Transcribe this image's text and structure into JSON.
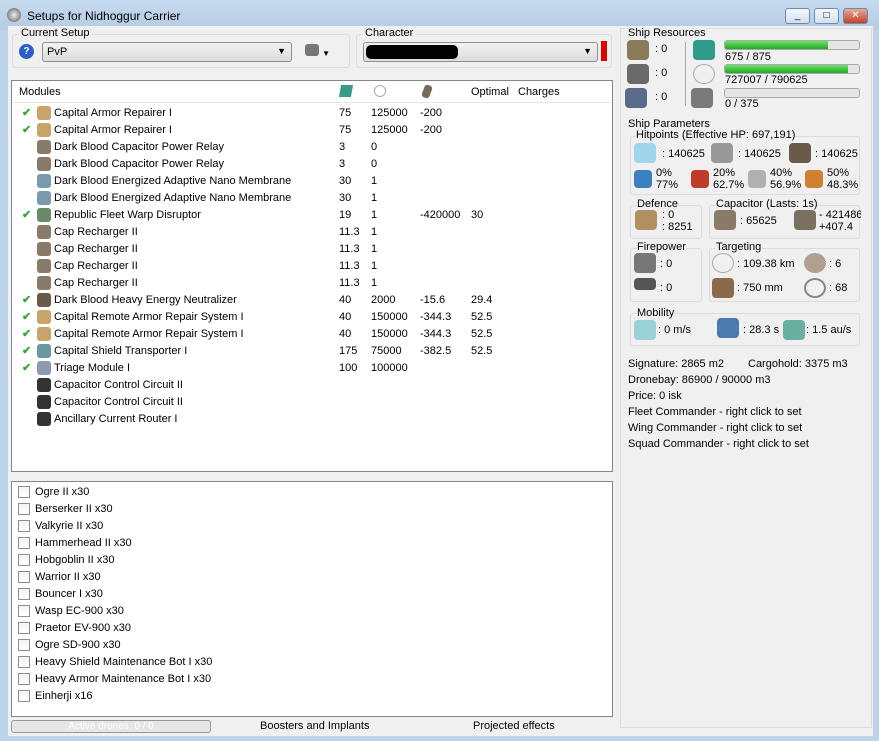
{
  "window": {
    "title": "Setups for Nidhoggur Carrier",
    "buttons": [
      "_",
      "□",
      "✕"
    ]
  },
  "setup": {
    "label": "Current Setup",
    "value": "PvP"
  },
  "character": {
    "label": "Character",
    "value": ""
  },
  "modules": {
    "headers": [
      "Modules",
      "",
      "",
      "",
      "Optimal",
      "Charges"
    ],
    "rows": [
      {
        "on": true,
        "name": "Capital Armor Repairer I",
        "cpu": "75",
        "pg": "125000",
        "cap": "-200",
        "opt": "",
        "icon": "#c9a46a"
      },
      {
        "on": true,
        "name": "Capital Armor Repairer I",
        "cpu": "75",
        "pg": "125000",
        "cap": "-200",
        "opt": "",
        "icon": "#c9a46a"
      },
      {
        "on": false,
        "name": "Dark Blood Capacitor Power Relay",
        "cpu": "3",
        "pg": "0",
        "cap": "",
        "opt": "",
        "icon": "#8a7a6a"
      },
      {
        "on": false,
        "name": "Dark Blood Capacitor Power Relay",
        "cpu": "3",
        "pg": "0",
        "cap": "",
        "opt": "",
        "icon": "#8a7a6a"
      },
      {
        "on": false,
        "name": "Dark Blood Energized Adaptive Nano Membrane",
        "cpu": "30",
        "pg": "1",
        "cap": "",
        "opt": "",
        "icon": "#7a9ab0"
      },
      {
        "on": false,
        "name": "Dark Blood Energized Adaptive Nano Membrane",
        "cpu": "30",
        "pg": "1",
        "cap": "",
        "opt": "",
        "icon": "#7a9ab0"
      },
      {
        "on": true,
        "name": "Republic Fleet Warp Disruptor",
        "cpu": "19",
        "pg": "1",
        "cap": "-420000",
        "opt": "30",
        "icon": "#6a8a6a"
      },
      {
        "on": false,
        "name": "Cap Recharger II",
        "cpu": "11.3",
        "pg": "1",
        "cap": "",
        "opt": "",
        "icon": "#8a7a6a"
      },
      {
        "on": false,
        "name": "Cap Recharger II",
        "cpu": "11.3",
        "pg": "1",
        "cap": "",
        "opt": "",
        "icon": "#8a7a6a"
      },
      {
        "on": false,
        "name": "Cap Recharger II",
        "cpu": "11.3",
        "pg": "1",
        "cap": "",
        "opt": "",
        "icon": "#8a7a6a"
      },
      {
        "on": false,
        "name": "Cap Recharger II",
        "cpu": "11.3",
        "pg": "1",
        "cap": "",
        "opt": "",
        "icon": "#8a7a6a"
      },
      {
        "on": true,
        "name": "Dark Blood Heavy Energy Neutralizer",
        "cpu": "40",
        "pg": "2000",
        "cap": "-15.6",
        "opt": "29.4",
        "icon": "#6a5a4a"
      },
      {
        "on": true,
        "name": "Capital Remote Armor Repair System I",
        "cpu": "40",
        "pg": "150000",
        "cap": "-344.3",
        "opt": "52.5",
        "icon": "#c9a46a"
      },
      {
        "on": true,
        "name": "Capital Remote Armor Repair System I",
        "cpu": "40",
        "pg": "150000",
        "cap": "-344.3",
        "opt": "52.5",
        "icon": "#c9a46a"
      },
      {
        "on": true,
        "name": "Capital Shield Transporter I",
        "cpu": "175",
        "pg": "75000",
        "cap": "-382.5",
        "opt": "52.5",
        "icon": "#6a9aa0"
      },
      {
        "on": true,
        "name": "Triage Module I",
        "cpu": "100",
        "pg": "100000",
        "cap": "",
        "opt": "",
        "icon": "#8a9ab0"
      },
      {
        "on": false,
        "name": "Capacitor Control Circuit II",
        "cpu": "",
        "pg": "",
        "cap": "",
        "opt": "",
        "icon": "#333"
      },
      {
        "on": false,
        "name": "Capacitor Control Circuit II",
        "cpu": "",
        "pg": "",
        "cap": "",
        "opt": "",
        "icon": "#333"
      },
      {
        "on": false,
        "name": "Ancillary Current Router I",
        "cpu": "",
        "pg": "",
        "cap": "",
        "opt": "",
        "icon": "#333"
      }
    ]
  },
  "drones": [
    "Ogre II x30",
    "Berserker II x30",
    "Valkyrie II x30",
    "Hammerhead II x30",
    "Hobgoblin II x30",
    "Warrior II x30",
    "Bouncer I x30",
    "Wasp EC-900 x30",
    "Praetor EV-900 x30",
    "Ogre SD-900 x30",
    "Heavy Shield Maintenance Bot I x30",
    "Heavy Armor Maintenance Bot I x30",
    "Einherji x16"
  ],
  "bottom": {
    "active_drones": "Active drones: 0 / 0",
    "active_drones_progress": 0,
    "tab_boosters": "Boosters and Implants",
    "tab_projected": "Projected effects"
  },
  "resources": {
    "label": "Ship Resources",
    "turrets": ": 0",
    "launchers": ": 0",
    "rigs": ": 0",
    "cpu": "675 / 875",
    "cpu_fraction": 0.77,
    "powergrid": "727007 / 790625",
    "pg_fraction": 0.92,
    "calibration": "0 / 375",
    "cal_fraction": 0
  },
  "params": {
    "label": "Ship Parameters",
    "hp_label": "Hitpoints (Effective HP: 697,191)",
    "shield": ": 140625",
    "armor": ": 140625",
    "hull": ": 140625",
    "resists": [
      [
        "0%",
        "77%"
      ],
      [
        "20%",
        "62.7%"
      ],
      [
        "40%",
        "56.9%"
      ],
      [
        "50%",
        "48.3%"
      ]
    ],
    "defence_label": "Defence",
    "def1": ": 0",
    "def2": ": 8251",
    "cap_label": "Capacitor (Lasts: 1s)",
    "cap_amount": ": 65625",
    "cap_delta1": "- 421486",
    "cap_delta2": "+407.4",
    "fire_label": "Firepower",
    "fire1": ": 0",
    "fire2": ": 0",
    "target_label": "Targeting",
    "range": ": 109.38 km",
    "targets": ": 6",
    "res": ": 750 mm",
    "scan": ": 68",
    "mob_label": "Mobility",
    "speed": ": 0 m/s",
    "align": ": 28.3 s",
    "warp": ": 1.5 au/s",
    "signature": "Signature: 2865 m2",
    "cargo": "Cargohold: 3375 m3",
    "dronebay": "Dronebay: 86900 / 90000 m3",
    "price": "Price: 0 isk",
    "fleet": "Fleet Commander - right click to set",
    "wing": "Wing Commander - right click to set",
    "squad": "Squad Commander - right click to set"
  },
  "colors": {
    "check": "#3aa534",
    "bar_fill": "#22b422",
    "char_indicator": "#e00000"
  }
}
